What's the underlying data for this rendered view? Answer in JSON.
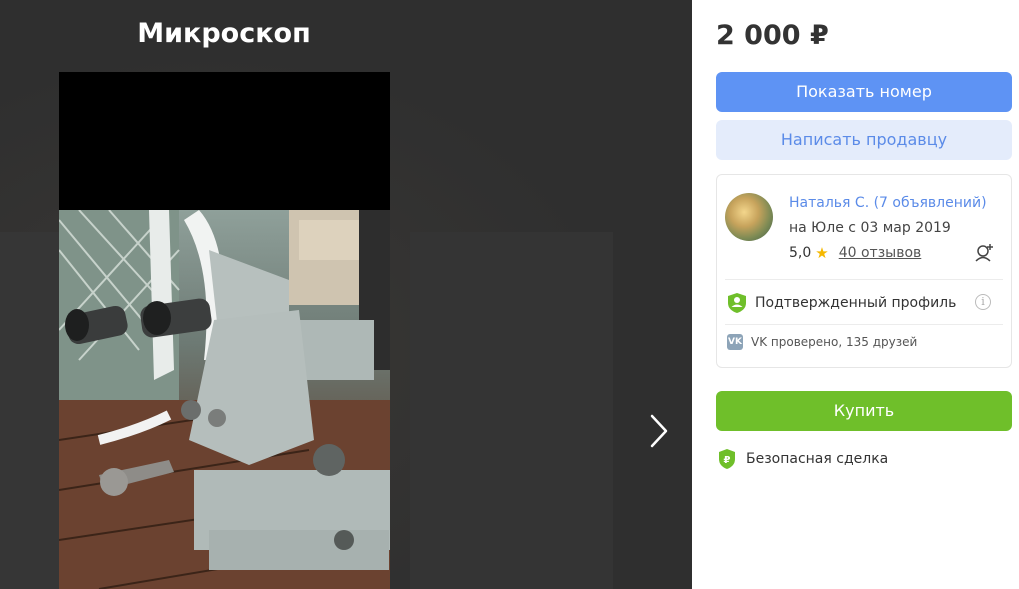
{
  "gallery": {
    "title": "Микроскоп",
    "next_icon": "chevron-right-icon"
  },
  "panel": {
    "price": "2 000 ₽",
    "show_phone_label": "Показать номер",
    "write_seller_label": "Написать продавцу",
    "buy_label": "Купить",
    "safe_deal_label": "Безопасная сделка"
  },
  "seller": {
    "name": "Наталья С. (7 объявлений)",
    "since": "на Юле с 03 мар 2019",
    "rating": "5,0",
    "reviews": "40 отзывов",
    "verified_label": "Подтвержденный профиль",
    "vk_label": "VK проверено, 135 друзей",
    "vk_badge": "VK"
  },
  "colors": {
    "primary_blue": "#5e93f4",
    "light_blue": "#e4ecfb",
    "buy_green": "#6fbf2a",
    "star_yellow": "#f5b800",
    "shield_green": "#6fbf2a"
  }
}
